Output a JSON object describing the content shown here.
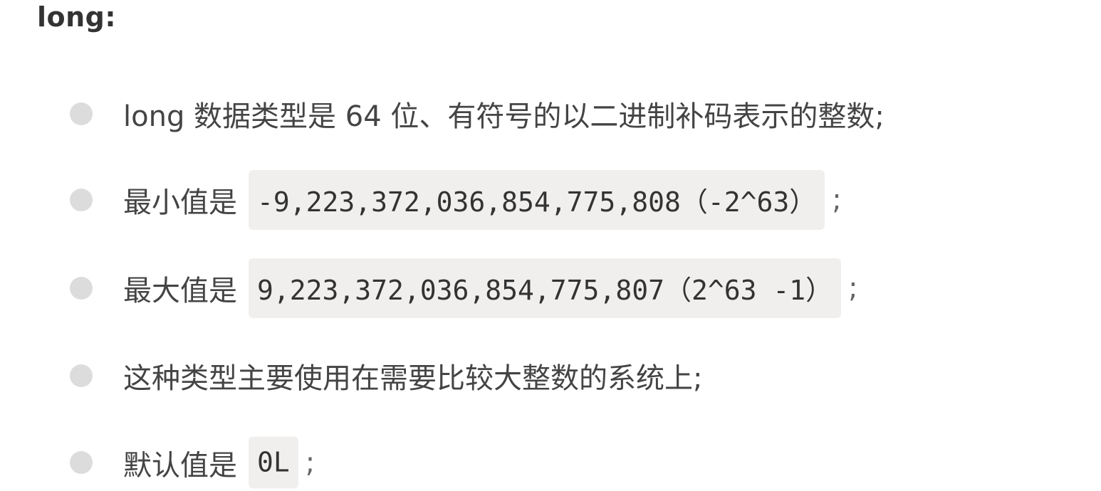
{
  "heading": "long:",
  "items": [
    {
      "text": "long 数据类型是 64 位、有符号的以二进制补码表示的整数;"
    },
    {
      "prefix": "最小值是",
      "code": "-9,223,372,036,854,775,808（-2^63）",
      "suffix": ";"
    },
    {
      "prefix": "最大值是",
      "code": "9,223,372,036,854,775,807（2^63 -1）",
      "suffix": ";"
    },
    {
      "text": "这种类型主要使用在需要比较大整数的系统上;"
    },
    {
      "prefix": "默认值是",
      "code": "0L",
      "suffix": ";"
    }
  ]
}
